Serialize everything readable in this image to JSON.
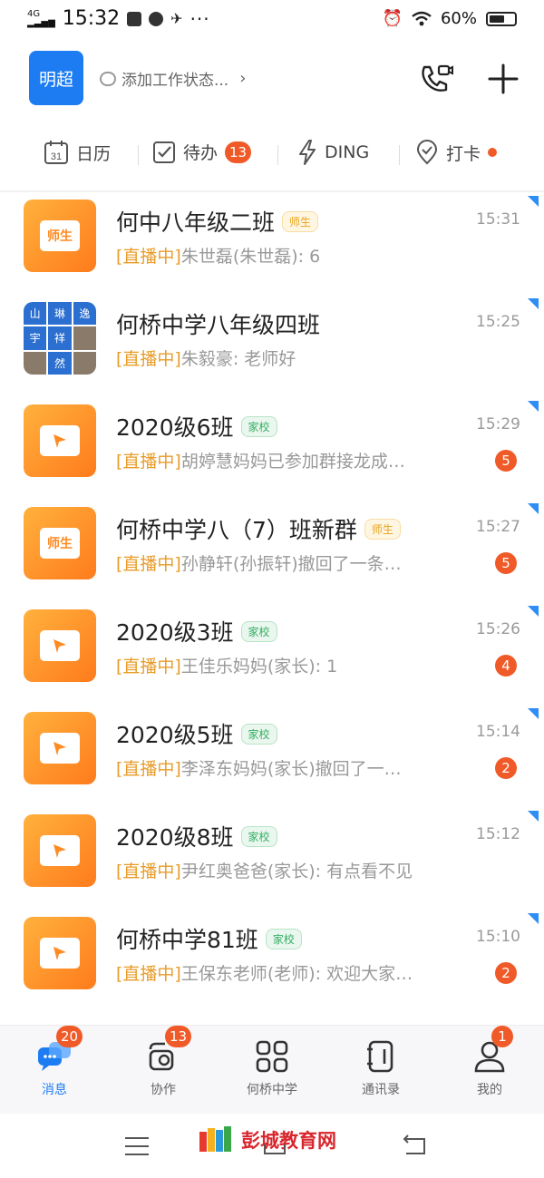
{
  "status_bar": {
    "network": "4G",
    "network_sub": "HD",
    "time": "15:32",
    "battery": "60%",
    "battery_level": 0.6,
    "more": "···"
  },
  "header": {
    "avatar_label": "明超",
    "work_status": "添加工作状态...",
    "chevron": "›"
  },
  "quickbar": {
    "calendar_icon_text": "31",
    "calendar": "日历",
    "todo": "待办",
    "todo_count": "13",
    "ding": "DING",
    "checkin": "打卡"
  },
  "chats": [
    {
      "avatar": "book",
      "avatar_text": "师生",
      "title": "何中八年级二班",
      "tag": "师生",
      "tag_type": "teacher",
      "time": "15:31",
      "live": "[直播中]",
      "preview": "朱世磊(朱世磊): 6",
      "count": ""
    },
    {
      "avatar": "grid",
      "avatar_cells": [
        "山",
        "琳",
        "逸",
        "宇",
        "祥",
        "",
        "",
        "然",
        ""
      ],
      "title": "何桥中学八年级四班",
      "tag": "",
      "tag_type": "",
      "time": "15:25",
      "live": "[直播中]",
      "preview": "朱毅豪: 老师好",
      "count": ""
    },
    {
      "avatar": "book",
      "avatar_text": "",
      "title": "2020级6班",
      "tag": "家校",
      "tag_type": "home",
      "time": "15:29",
      "live": "[直播中]",
      "preview": "胡婷慧妈妈已参加群接龙成…",
      "count": "5"
    },
    {
      "avatar": "book",
      "avatar_text": "师生",
      "title": "何桥中学八（7）班新群",
      "tag": "师生",
      "tag_type": "teacher",
      "time": "15:27",
      "live": "[直播中]",
      "preview": "孙静轩(孙振轩)撤回了一条…",
      "count": "5"
    },
    {
      "avatar": "book",
      "avatar_text": "",
      "title": "2020级3班",
      "tag": "家校",
      "tag_type": "home",
      "time": "15:26",
      "live": "[直播中]",
      "preview": "王佳乐妈妈(家长): 1",
      "count": "4"
    },
    {
      "avatar": "book",
      "avatar_text": "",
      "title": "2020级5班",
      "tag": "家校",
      "tag_type": "home",
      "time": "15:14",
      "live": "[直播中]",
      "preview": "李泽东妈妈(家长)撤回了一…",
      "count": "2"
    },
    {
      "avatar": "book",
      "avatar_text": "",
      "title": "2020级8班",
      "tag": "家校",
      "tag_type": "home",
      "time": "15:12",
      "live": "[直播中]",
      "preview": "尹红奥爸爸(家长): 有点看不见",
      "count": ""
    },
    {
      "avatar": "book",
      "avatar_text": "",
      "title": "何桥中学81班",
      "tag": "家校",
      "tag_type": "home",
      "time": "15:10",
      "live": "[直播中]",
      "preview": "王保东老师(老师): 欢迎大家…",
      "count": "2"
    }
  ],
  "tabs": [
    {
      "label": "消息",
      "badge": "20",
      "icon": "message-icon"
    },
    {
      "label": "协作",
      "badge": "13",
      "icon": "collab-icon"
    },
    {
      "label": "何桥中学",
      "badge": "",
      "icon": "workbench-grid-icon"
    },
    {
      "label": "通讯录",
      "badge": "",
      "icon": "contacts-icon"
    },
    {
      "label": "我的",
      "badge": "1",
      "icon": "profile-icon"
    }
  ],
  "watermark": "彭城教育网",
  "colors": {
    "accent": "#1d7cf2",
    "badge": "#f05a28",
    "live": "#e89c2a",
    "avatar_gradient": [
      "#ffb13d",
      "#ff7b1c"
    ]
  }
}
